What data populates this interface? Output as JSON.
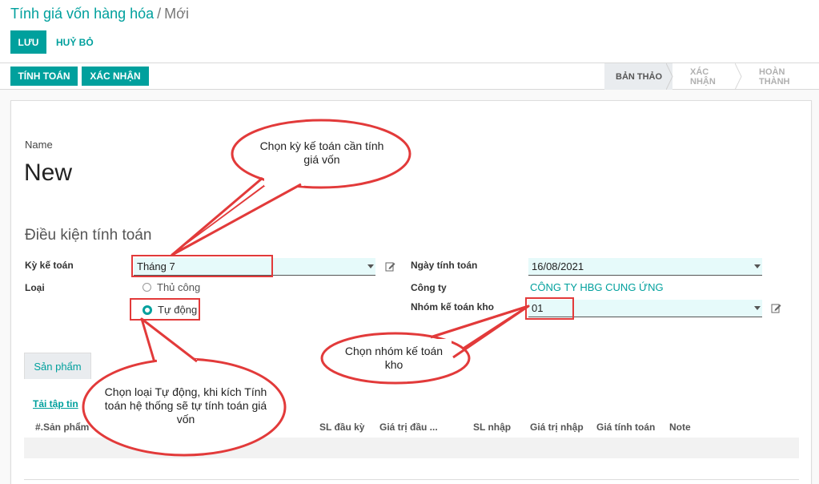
{
  "breadcrumb": {
    "parent": "Tính giá vốn hàng hóa",
    "separator": "/",
    "current": "Mới"
  },
  "toolbar": {
    "save_label": "LƯU",
    "discard_label": "HUỶ BỎ"
  },
  "statusbar": {
    "compute_label": "TÍNH TOÁN",
    "confirm_label": "XÁC NHẬN",
    "steps": [
      "BẢN THẢO",
      "XÁC NHẬN",
      "HOÀN THÀNH"
    ],
    "current_step": "BẢN THẢO"
  },
  "form": {
    "name_label": "Name",
    "name_value": "New",
    "group_title": "Điều kiện tính toán",
    "period_label": "Kỳ kế toán",
    "period_value": "Tháng 7",
    "type_label": "Loại",
    "type_options": [
      "Thủ công",
      "Tự động"
    ],
    "type_selected": "Tự động",
    "date_label": "Ngày tính toán",
    "date_value": "16/08/2021",
    "company_label": "Công ty",
    "company_value": "CÔNG TY HBG CUNG ỨNG",
    "stock_group_label": "Nhóm kế toán kho",
    "stock_group_value": "01"
  },
  "tabs": {
    "products": "Sản phẩm"
  },
  "table": {
    "download_link": "Tải tập tin",
    "columns": [
      "#.Sản phẩm",
      "SL đầu kỳ",
      "Giá trị đầu ...",
      "SL nhập",
      "Giá trị nhập",
      "Giá tính toán",
      "Note"
    ]
  },
  "annotations": {
    "callout_period": "Chọn kỳ kế toán cần tính giá vốn",
    "callout_group": "Chọn nhóm kế toán kho",
    "callout_type": "Chọn loại Tự động, khi kích Tính toán hệ thống sẽ tự tính toán giá vốn"
  },
  "colors": {
    "accent": "#00a09d",
    "callout_border": "#e23a3a",
    "input_bg": "#e6fafa"
  }
}
